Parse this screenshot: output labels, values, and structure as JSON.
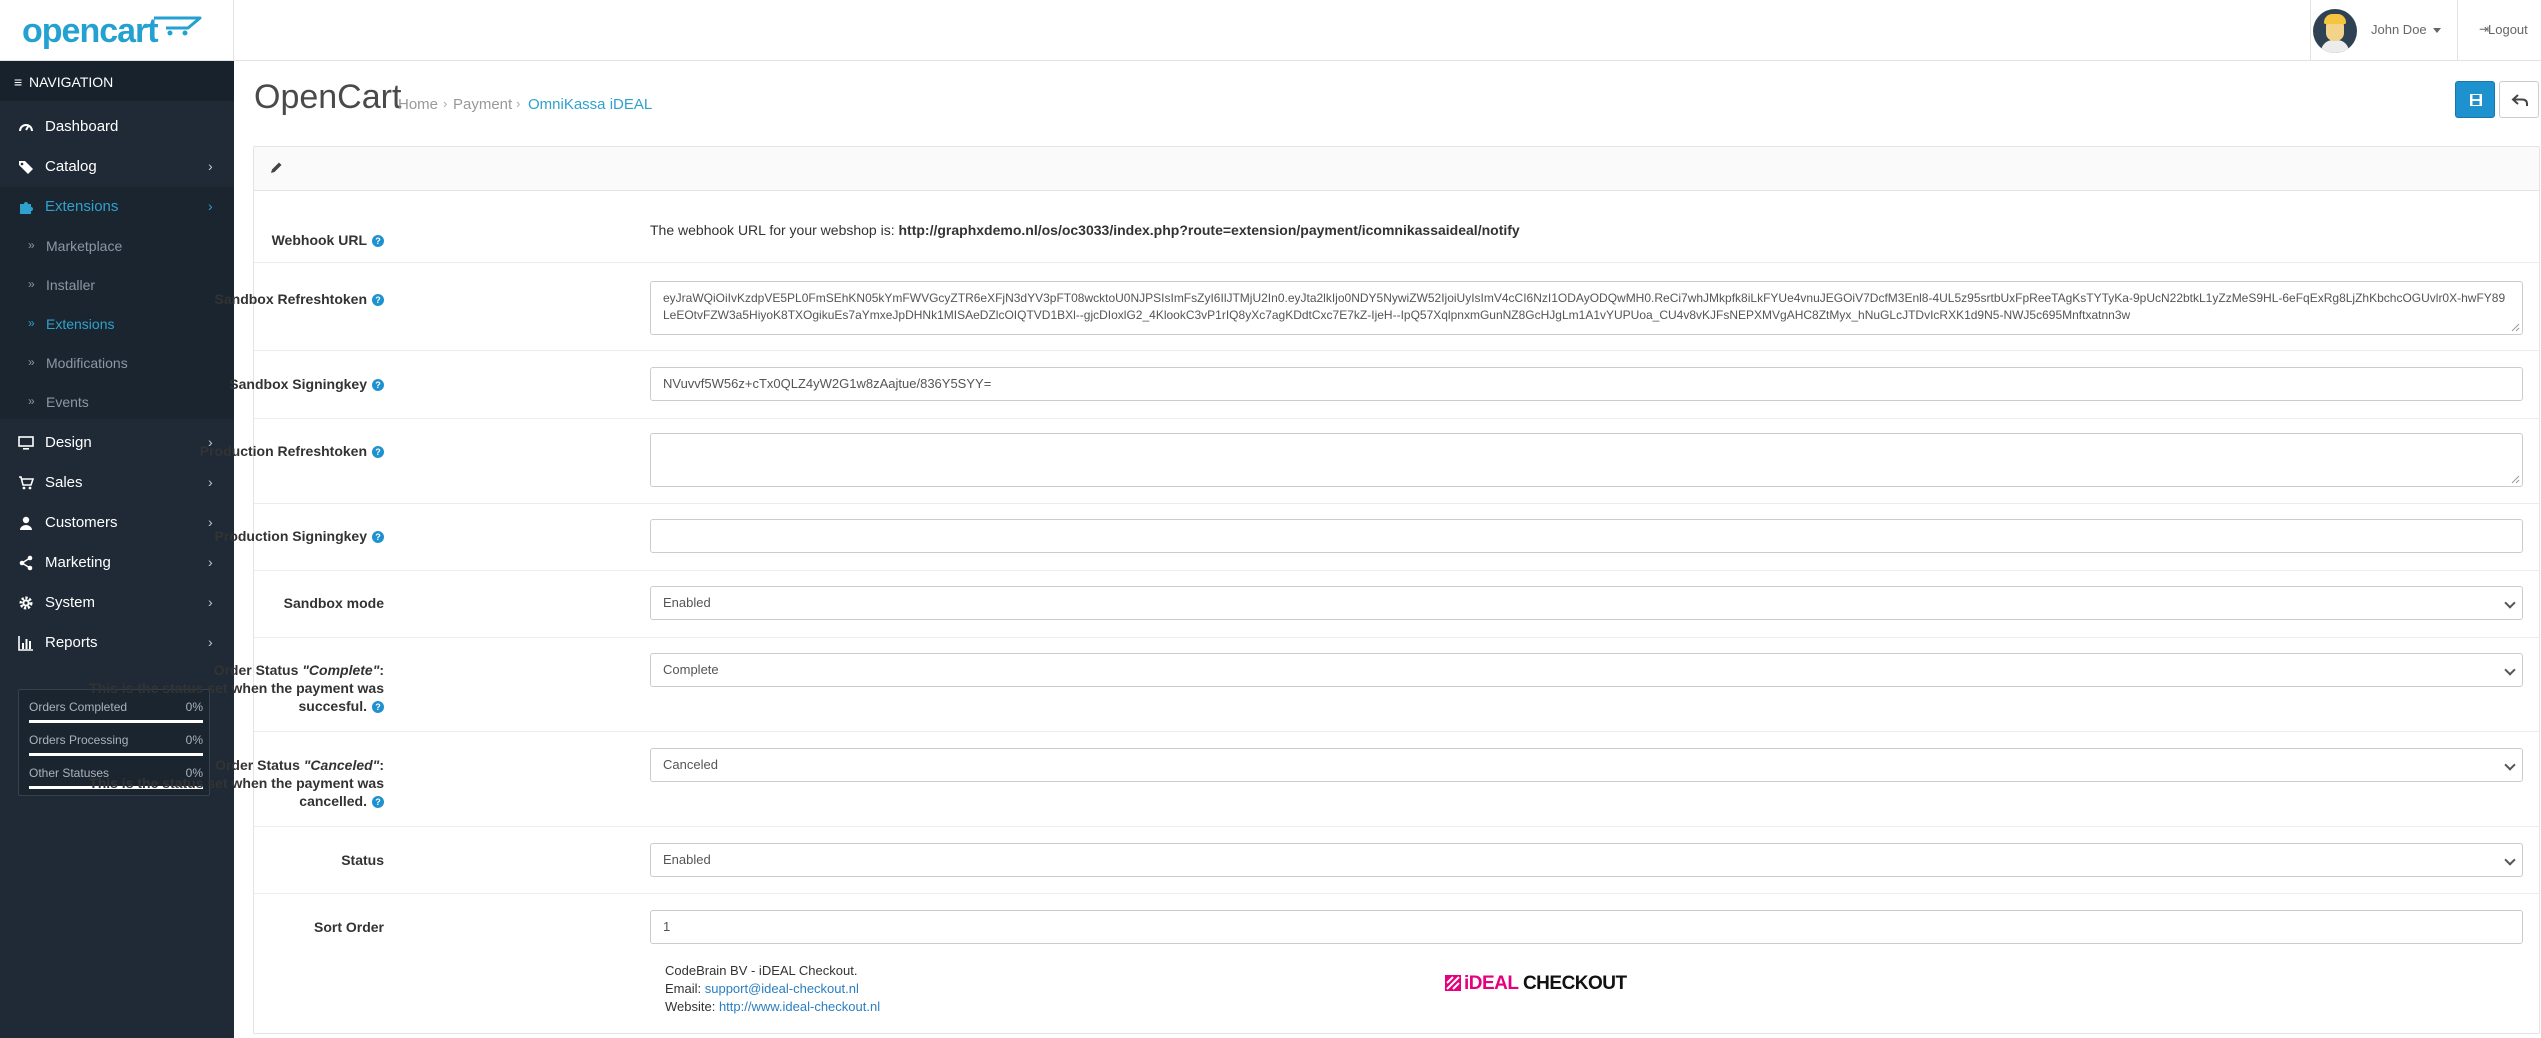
{
  "header": {
    "logo_text": "opencart",
    "user_name": "John Doe",
    "logout_label": "Logout"
  },
  "sidebar": {
    "nav_header": "NAVIGATION",
    "items": [
      {
        "label": "Dashboard",
        "icon": "dashboard-icon"
      },
      {
        "label": "Catalog",
        "icon": "tags-icon"
      },
      {
        "label": "Extensions",
        "icon": "puzzle-icon"
      },
      {
        "label": "Design",
        "icon": "monitor-icon"
      },
      {
        "label": "Sales",
        "icon": "cart-icon"
      },
      {
        "label": "Customers",
        "icon": "user-icon"
      },
      {
        "label": "Marketing",
        "icon": "share-icon"
      },
      {
        "label": "System",
        "icon": "gear-icon"
      },
      {
        "label": "Reports",
        "icon": "bar-chart-icon"
      }
    ],
    "extensions_sub": [
      {
        "label": "Marketplace"
      },
      {
        "label": "Installer"
      },
      {
        "label": "Extensions"
      },
      {
        "label": "Modifications"
      },
      {
        "label": "Events"
      }
    ],
    "stats": [
      {
        "label": "Orders Completed",
        "percent": "0%",
        "progress": 0
      },
      {
        "label": "Orders Processing",
        "percent": "0%",
        "progress": 0
      },
      {
        "label": "Other Statuses",
        "percent": "0%",
        "progress": 0
      }
    ]
  },
  "page": {
    "title": "OpenCart",
    "breadcrumb": [
      "Home",
      "Payment",
      "OmniKassa iDEAL"
    ]
  },
  "form": {
    "webhook": {
      "label": "Webhook URL",
      "text": "The webhook URL for your webshop is: ",
      "url": "http://graphxdemo.nl/os/oc3033/index.php?route=extension/payment/icomnikassaideal/notify"
    },
    "sandbox_refreshtoken": {
      "label": "Sandbox Refreshtoken",
      "value": "eyJraWQiOiIvKzdpVE5PL0FmSEhKN05kYmFWVGcyZTR6eXFjN3dYV3pFT08wcktoU0NJPSIsImFsZyI6IlJTMjU2In0.eyJta2lkIjo0NDY5NywiZW52IjoiUyIsImV4cCI6NzI1ODAyODQwMH0.ReCi7whJMkpfk8iLkFYUe4vnuJEGOiV7DcfM3Enl8-4UL5z95srtbUxFpReeTAgKsTYTyKa-9pUcN22btkL1yZzMeS9HL-6eFqExRg8LjZhKbchcOGUvlr0X-hwFY89LeEOtvFZW3a5HiyoK8TXOgikuEs7aYmxeJpDHNk1MISAeDZlcOIQTVD1BXl--gjcDIoxlG2_4KlookC3vP1rIQ8yXc7agKDdtCxc7E7kZ-IjeH--IpQ57XqlpnxmGunNZ8GcHJgLm1A1vYUPUoa_CU4v8vKJFsNEPXMVgAHC8ZtMyx_hNuGLcJTDvIcRXK1d9N5-NWJ5c695Mnftxatnn3w"
    },
    "sandbox_signingkey": {
      "label": "Sandbox Signingkey",
      "value": "NVuvvf5W56z+cTx0QLZ4yW2G1w8zAajtue/836Y5SYY="
    },
    "production_refreshtoken": {
      "label": "Production Refreshtoken",
      "value": ""
    },
    "production_signingkey": {
      "label": "Production Signingkey",
      "value": ""
    },
    "sandbox_mode": {
      "label": "Sandbox mode",
      "value": "Enabled"
    },
    "order_status_complete": {
      "label_prefix": "Order Status ",
      "label_quote": "\"Complete\"",
      "label_suffix": ":",
      "label_line2": "This is the status set when the payment was",
      "label_line3": "succesful.",
      "value": "Complete"
    },
    "order_status_canceled": {
      "label_prefix": "Order Status ",
      "label_quote": "\"Canceled\"",
      "label_suffix": ":",
      "label_line2": "This is the status set when the payment was",
      "label_line3": "cancelled.",
      "value": "Canceled"
    },
    "status": {
      "label": "Status",
      "value": "Enabled"
    },
    "sort_order": {
      "label": "Sort Order",
      "value": "1"
    }
  },
  "footer_info": {
    "company": "CodeBrain BV - iDEAL Checkout.",
    "email_label": "Email: ",
    "email": "support@ideal-checkout.nl",
    "website_label": "Website: ",
    "website": "http://www.ideal-checkout.nl",
    "logo_ideal": "iDEAL",
    "logo_checkout": " CHECKOUT"
  },
  "colors": {
    "accent": "#1e91cf",
    "sidebar_bg": "#1f2a36",
    "active_link": "#2ea2cc",
    "brand_pink": "#e6007e"
  }
}
